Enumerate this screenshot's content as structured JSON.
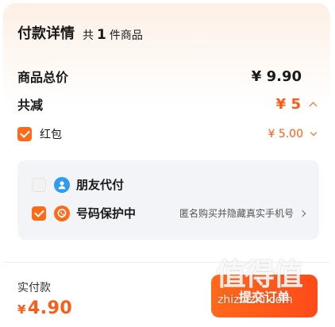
{
  "header": {
    "title": "付款详情",
    "count_prefix": "共",
    "count_value": "1",
    "count_suffix": "件商品"
  },
  "total": {
    "label": "商品总价",
    "value": "¥ 9.90"
  },
  "discount": {
    "label": "共减",
    "value": "¥ 5"
  },
  "red_packet": {
    "label": "红包",
    "value": "¥ 5.00",
    "checked": true
  },
  "options": {
    "friend_pay": {
      "label": "朋友代付",
      "checked": false,
      "icon": "friend-pay-icon"
    },
    "number_protect": {
      "label": "号码保护中",
      "hint": "匿名购买并隐藏真实手机号",
      "checked": true,
      "icon": "phone-protect-icon"
    }
  },
  "footer": {
    "pay_label": "实付款",
    "pay_currency": "¥",
    "pay_amount": "4.90",
    "submit_label": "提交订单"
  },
  "watermark": {
    "big": "值得值",
    "small": "zhizhizhi.com"
  },
  "colors": {
    "accent": "#ff5b14",
    "panel_bg": "#f2f4f7",
    "friend_icon": "#2f9cf0"
  }
}
